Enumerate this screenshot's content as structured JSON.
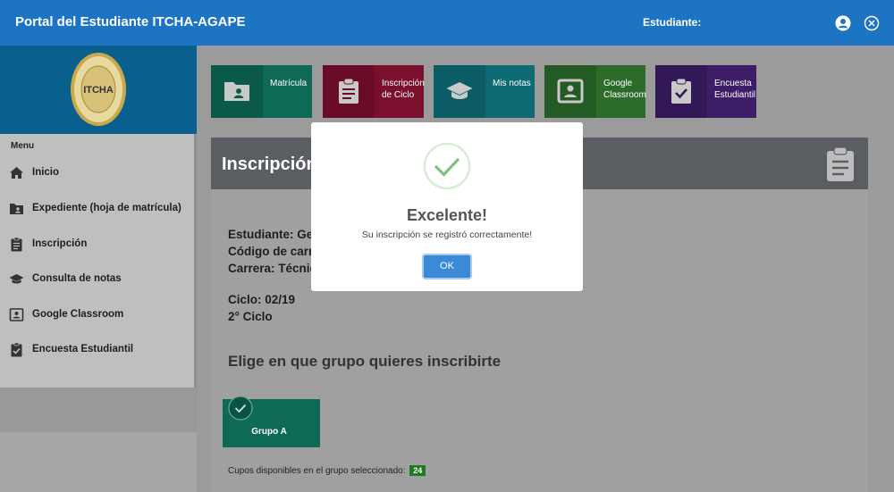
{
  "header": {
    "title": "Portal del Estudiante ITCHA-AGAPE",
    "student_label": "Estudiante:",
    "bg_color": "#1c74c2"
  },
  "sidebar": {
    "logo_text": "ITCHA",
    "menu_title": "Menu",
    "items": [
      {
        "label": "Inicio",
        "icon": "home-icon"
      },
      {
        "label": "Expediente (hoja de matrícula)",
        "icon": "folder-user-icon"
      },
      {
        "label": "Inscripción",
        "icon": "clipboard-icon"
      },
      {
        "label": "Consulta de notas",
        "icon": "graduation-cap-icon"
      },
      {
        "label": "Google Classroom",
        "icon": "classroom-icon"
      },
      {
        "label": "Encuesta Estudiantil",
        "icon": "clipboard-check-icon"
      }
    ]
  },
  "tiles": [
    {
      "label": "Matrícula",
      "icon": "folder-user-icon",
      "color": "#0f6a55"
    },
    {
      "label": "Inscripción de Ciclo",
      "icon": "clipboard-icon",
      "color": "#7a0f2e"
    },
    {
      "label": "Mis notas",
      "icon": "graduation-cap-icon",
      "color": "#0e6b74"
    },
    {
      "label": "Google Classroom",
      "icon": "classroom-icon",
      "color": "#2d6b2b"
    },
    {
      "label": "Encuesta Estudiantil",
      "icon": "clipboard-check-icon",
      "color": "#3d1d67"
    }
  ],
  "panel": {
    "title": "Inscripción",
    "student_line": "Estudiante: Ger",
    "code_line": "Código de carne",
    "career_line": "Carrera: Técnic",
    "cycle_line": "Ciclo: 02/19",
    "cycle_ordinal": "2° Ciclo",
    "choose_heading": "Elige en que grupo quieres inscribirte",
    "group_label": "Grupo A",
    "cupos_label": "Cupos disponibles en el grupo seleccionado:",
    "cupos_value": "24"
  },
  "modal": {
    "title": "Excelente!",
    "message": "Su inscripción se registró correctamente!",
    "ok_label": "OK",
    "accent_color": "#7ec07c"
  }
}
